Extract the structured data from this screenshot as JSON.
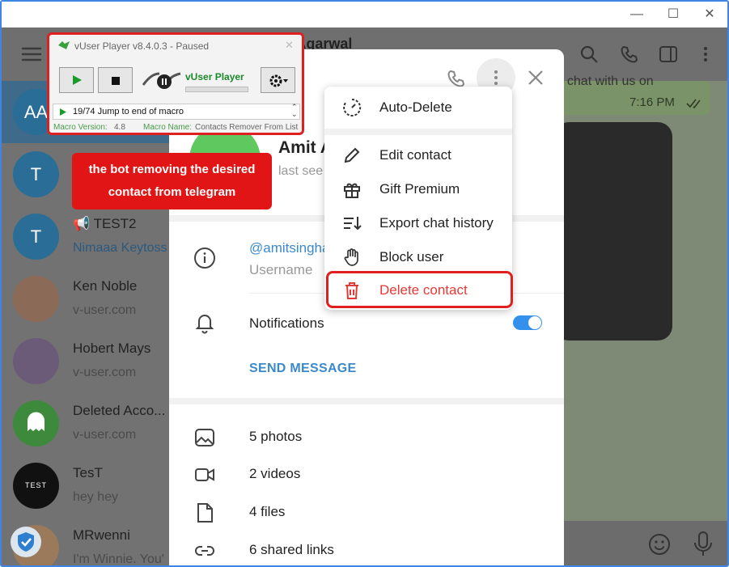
{
  "vuser": {
    "title": "vUser Player v8.4.0.3 - Paused",
    "brand": "vUser Player",
    "step": "19/74 Jump to end of macro",
    "version_label": "Macro Version:",
    "version": "4.8",
    "name_label": "Macro Name:",
    "name": "Contacts Remover From List"
  },
  "callout": {
    "line1": "the bot removing the desired",
    "line2": "contact from telegram"
  },
  "header": {
    "chat_title": "t Agarwal"
  },
  "sidebar": {
    "items": [
      {
        "avatar": "AA",
        "name": "",
        "msg": "",
        "color": "#2a6d96"
      },
      {
        "avatar": "T",
        "name": "",
        "msg": "",
        "color": "#2a6d96"
      },
      {
        "avatar": "T",
        "name": "📢 TEST2",
        "msg": "Nimaaa Keytoss",
        "color": "#2a6d96"
      },
      {
        "avatar": "",
        "name": "Ken Noble",
        "msg": "v-user.com",
        "color": "#8b6a58"
      },
      {
        "avatar": "",
        "name": "Hobert Mays",
        "msg": "v-user.com",
        "color": "#6b5a78"
      },
      {
        "avatar": "",
        "name": "Deleted Acco...",
        "msg": "v-user.com",
        "color": "#3d8a3d"
      },
      {
        "avatar": "TEST",
        "name": "TesT",
        "msg": "hey hey",
        "color": "#111111"
      },
      {
        "avatar": "",
        "name": "MRwenni",
        "msg": "I'm Winnie. You'",
        "color": "#9a7a5a"
      }
    ]
  },
  "chat": {
    "bubble_text": "plz chat with us on",
    "time": "7:16 PM"
  },
  "profile": {
    "name": "Amit A",
    "status": "last see",
    "username": "@amitsingha",
    "username_label": "Username",
    "notifications": "Notifications",
    "send_message": "SEND MESSAGE",
    "photos": "5 photos",
    "videos": "2 videos",
    "files": "4 files",
    "links": "6 shared links"
  },
  "menu": {
    "auto_delete": "Auto-Delete",
    "edit": "Edit contact",
    "gift": "Gift Premium",
    "export": "Export chat history",
    "block": "Block user",
    "delete": "Delete contact"
  },
  "colors": {
    "accent": "#3390ec",
    "danger": "#e53935",
    "highlight": "#e02020"
  }
}
